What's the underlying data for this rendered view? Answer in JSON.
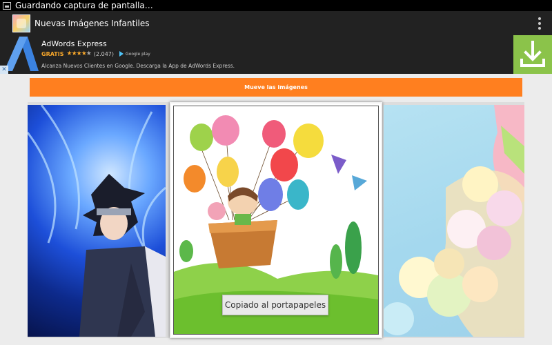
{
  "status_bar": {
    "text": "Guardando captura de pantalla…"
  },
  "app_bar": {
    "title": "Nuevas Imágenes Infantiles"
  },
  "ad": {
    "title": "AdWords Express",
    "price": "GRATIS",
    "stars": "★★★★",
    "star_empty": "★",
    "reviews": "(2.047)",
    "store": "Google play",
    "description": "Alcanza Nuevos Clientes en Google. Descarga la App de AdWords Express.",
    "close": "✕",
    "colors": {
      "price": "#f7a72b",
      "download_bg": "#8bc34a"
    }
  },
  "buttons": {
    "move_images": "Mueve las imágenes"
  },
  "toast": {
    "text": "Copiado al portapapeles"
  },
  "colors": {
    "accent": "#ff7f1f",
    "bar_bg": "#222222",
    "page_bg": "#ececec"
  }
}
